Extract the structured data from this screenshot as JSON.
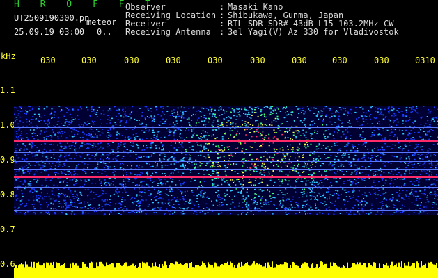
{
  "header": {
    "app_title": "H R O F F T",
    "file_name": "UT2509190300.pn",
    "mode": "meteor",
    "datetime": "25.09.19 03:00",
    "count": "0..",
    "fields": [
      {
        "label": "Observer",
        "value": "Masaki Kano"
      },
      {
        "label": "Receiving Location",
        "value": "Shibukawa, Gunma, Japan"
      },
      {
        "label": "Receiver",
        "value": "RTL-SDR SDR# 43dB L15 103.2MHz CW"
      },
      {
        "label": "Receiving Antenna",
        "value": "3el Yagi(V) Az 330 for Vladivostok"
      }
    ],
    "separator": ":"
  },
  "axis": {
    "unit_label": "kHz",
    "y_ticks": [
      "1.1",
      "1.0",
      "0.9",
      "0.8",
      "0.7",
      "0.6"
    ],
    "x_ticks": [
      "030",
      "030",
      "030",
      "030",
      "030",
      "030",
      "030",
      "030",
      "030",
      "0310"
    ]
  },
  "colors": {
    "background": "#000000",
    "title": "#2fcf2f",
    "header_text": "#dcdcdc",
    "axis": "#ffff33",
    "hot": "#ff2a6a",
    "noise_low": "#1a3cff",
    "noise_mid": "#30c8ff",
    "noise_high": "#ffff40",
    "amplitude": "#ffff00"
  }
}
